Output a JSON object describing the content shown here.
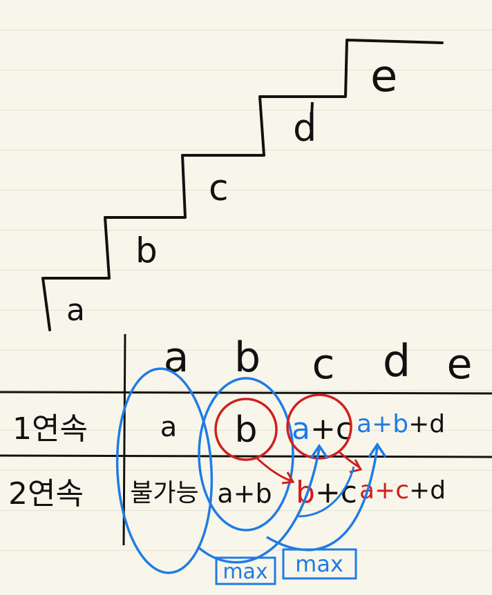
{
  "stairs": {
    "steps": [
      "a",
      "b",
      "c",
      "d",
      "e"
    ]
  },
  "table": {
    "columns": [
      "a",
      "b",
      "c",
      "d",
      "e"
    ],
    "rows": [
      {
        "label": "1연속",
        "cells": [
          {
            "text": "a"
          },
          {
            "text": "b"
          },
          {
            "parts": [
              {
                "t": "a",
                "c": "#1f7be6"
              },
              {
                "t": "+c",
                "c": "#111111"
              }
            ]
          },
          {
            "parts": [
              {
                "t": "a+b",
                "c": "#1f7be6"
              },
              {
                "t": "+d",
                "c": "#111111"
              }
            ]
          }
        ]
      },
      {
        "label": "2연속",
        "cells": [
          {
            "text": "불가능"
          },
          {
            "text": "a+b"
          },
          {
            "parts": [
              {
                "t": "b",
                "c": "#d01f1f"
              },
              {
                "t": "+c",
                "c": "#111111"
              }
            ]
          },
          {
            "parts": [
              {
                "t": "a+c",
                "c": "#d01f1f"
              },
              {
                "t": "+d",
                "c": "#111111"
              }
            ]
          }
        ]
      }
    ]
  },
  "annotations": {
    "max_1": "max",
    "max_2": "max"
  },
  "colors": {
    "ink": "#111111",
    "blue": "#1f7be6",
    "red": "#d01f1f",
    "paper": "#f8f6ea"
  }
}
